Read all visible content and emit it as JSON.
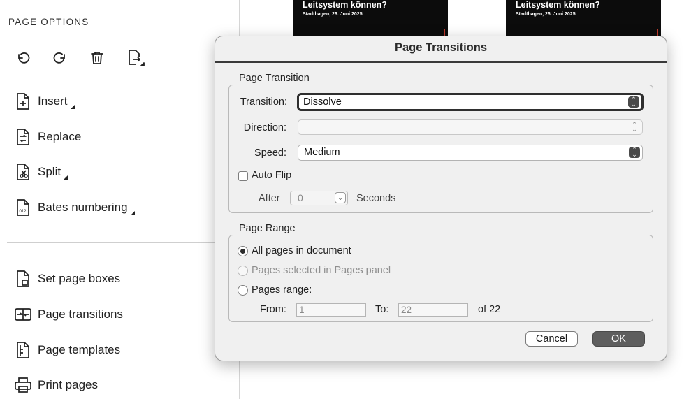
{
  "left_panel": {
    "title": "PAGE OPTIONS",
    "toolbar": [
      {
        "name": "undo-icon"
      },
      {
        "name": "redo-icon"
      },
      {
        "name": "trash-icon"
      },
      {
        "name": "export-page-icon"
      }
    ],
    "items": [
      {
        "label": "Insert",
        "icon": "insert-page-icon",
        "submenu": true
      },
      {
        "label": "Replace",
        "icon": "replace-page-icon",
        "submenu": false
      },
      {
        "label": "Split",
        "icon": "split-page-icon",
        "submenu": true
      },
      {
        "label": "Bates numbering",
        "icon": "bates-numbering-icon",
        "submenu": true
      },
      {
        "label": "Set page boxes",
        "icon": "page-box-icon",
        "submenu": false
      },
      {
        "label": "Page transitions",
        "icon": "page-transitions-icon",
        "submenu": false
      },
      {
        "label": "Page templates",
        "icon": "page-templates-icon",
        "submenu": false
      },
      {
        "label": "Print pages",
        "icon": "printer-icon",
        "submenu": false
      }
    ]
  },
  "thumbnails": [
    {
      "title": "Leitsystem können?",
      "subtitle": "Stadthagen, 26. Juni 2025"
    },
    {
      "title": "Leitsystem können?",
      "subtitle": "Stadthagen, 26. Juni 2025"
    }
  ],
  "dialog": {
    "title": "Page Transitions",
    "page_transition": {
      "section_label": "Page Transition",
      "transition_label": "Transition:",
      "transition_value": "Dissolve",
      "direction_label": "Direction:",
      "direction_value": "",
      "speed_label": "Speed:",
      "speed_value": "Medium",
      "auto_flip_label": "Auto Flip",
      "auto_flip_checked": false,
      "after_label": "After",
      "after_value": "0",
      "seconds_label": "Seconds"
    },
    "page_range": {
      "section_label": "Page Range",
      "options": [
        {
          "label": "All pages in document",
          "checked": true,
          "disabled": false
        },
        {
          "label": "Pages selected in Pages panel",
          "checked": false,
          "disabled": true
        },
        {
          "label": "Pages range:",
          "checked": false,
          "disabled": false
        }
      ],
      "from_label": "From:",
      "from_value": "1",
      "to_label": "To:",
      "to_value": "22",
      "of_text": "of 22"
    },
    "buttons": {
      "cancel": "Cancel",
      "ok": "OK"
    }
  }
}
